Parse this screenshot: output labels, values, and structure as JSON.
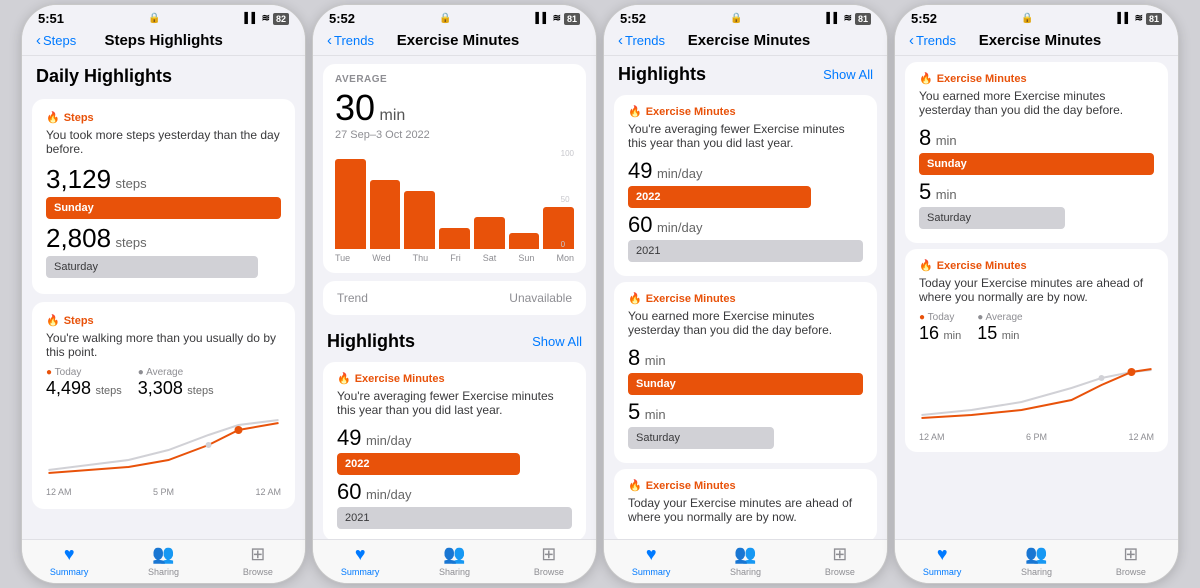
{
  "phones": [
    {
      "id": "phone1",
      "statusBar": {
        "time": "5:51",
        "icons": "▌▌ ≋ 82"
      },
      "navBack": "Steps",
      "navTitle": "Steps Highlights",
      "dailyHighlightsTitle": "Daily Highlights",
      "card1": {
        "category": "Steps",
        "desc": "You took more steps yesterday than the day before.",
        "value1": "3,129",
        "unit1": "steps",
        "bar1": "Sunday",
        "value2": "2,808",
        "unit2": "steps",
        "bar2": "Saturday"
      },
      "card2": {
        "category": "Steps",
        "desc": "You're walking more than you usually do by this point.",
        "todayLabel": "Today",
        "todayValue": "4,498",
        "todayUnit": "steps",
        "avgLabel": "Average",
        "avgValue": "3,308",
        "avgUnit": "steps"
      },
      "chartAxisLabels": [
        "12 AM",
        "5 PM",
        "12 AM"
      ],
      "tabItems": [
        {
          "label": "Summary",
          "icon": "♥",
          "active": true
        },
        {
          "label": "Sharing",
          "icon": "👤"
        },
        {
          "label": "Browse",
          "icon": "⊞"
        }
      ]
    },
    {
      "id": "phone2",
      "statusBar": {
        "time": "5:52",
        "icons": "▌▌ ≋ 81"
      },
      "navBack": "Trends",
      "navTitle": "Exercise Minutes",
      "avgLabel": "AVERAGE",
      "bigNumber": "30",
      "bigUnit": "min",
      "dateRange": "27 Sep–3 Oct 2022",
      "barChartLabels": [
        "Tue",
        "Wed",
        "Thu",
        "Fri",
        "Sat",
        "Sun",
        "Mon"
      ],
      "barChartValues": [
        85,
        65,
        55,
        20,
        30,
        15,
        40
      ],
      "barChartYLabels": [
        "100",
        "50",
        "0"
      ],
      "trendLabel": "Trend",
      "trendStatus": "Unavailable",
      "highlightsTitle": "Highlights",
      "showAllLabel": "Show All",
      "highlight1": {
        "category": "Exercise Minutes",
        "desc": "You're averaging fewer Exercise minutes this year than you did last year.",
        "value1": "49",
        "unit1": "min/day",
        "bar1": "2022",
        "value2": "60"
      },
      "tabItems": [
        {
          "label": "Summary",
          "icon": "♥",
          "active": true
        },
        {
          "label": "Sharing",
          "icon": "👤"
        },
        {
          "label": "Browse",
          "icon": "⊞"
        }
      ]
    },
    {
      "id": "phone3",
      "statusBar": {
        "time": "5:52",
        "icons": "▌▌ ≋ 81"
      },
      "navBack": "Trends",
      "navTitle": "Exercise Minutes",
      "highlightsTitle": "Highlights",
      "showAllLabel": "Show All",
      "highlight1": {
        "category": "Exercise Minutes",
        "desc": "You're averaging fewer Exercise minutes this year than you did last year.",
        "value1": "49",
        "unit1": "min/day",
        "bar1": "2022",
        "bar1Width": "78",
        "value2": "60",
        "unit2": "min/day",
        "bar2": "2021",
        "bar2Width": "100"
      },
      "highlight2": {
        "category": "Exercise Minutes",
        "desc": "You earned more Exercise minutes yesterday than you did the day before.",
        "value1": "8",
        "unit1": "min",
        "bar1": "Sunday",
        "value2": "5",
        "unit2": "min",
        "bar2": "Saturday"
      },
      "highlight3": {
        "category": "Exercise Minutes",
        "desc": "Today your Exercise minutes are ahead of where you normally are by now."
      },
      "tabItems": [
        {
          "label": "Summary",
          "icon": "♥",
          "active": true
        },
        {
          "label": "Sharing",
          "icon": "👤"
        },
        {
          "label": "Browse",
          "icon": "⊞"
        }
      ]
    },
    {
      "id": "phone4",
      "statusBar": {
        "time": "5:52",
        "icons": "▌▌ ≋ 81"
      },
      "navBack": "Trends",
      "navTitle": "Exercise Minutes",
      "highlight1": {
        "category": "Exercise Minutes",
        "desc": "You earned more Exercise minutes yesterday than you did the day before.",
        "value1": "8",
        "unit1": "min",
        "bar1": "Sunday",
        "bar1Width": "100",
        "value2": "5",
        "unit2": "min",
        "bar2": "Saturday",
        "bar2Width": "62"
      },
      "highlight2": {
        "category": "Exercise Minutes",
        "desc": "Today your Exercise minutes are ahead of where you normally are by now.",
        "todayLabel": "Today",
        "todayValue": "16",
        "todayUnit": "min",
        "avgLabel": "Average",
        "avgValue": "15",
        "avgUnit": "min"
      },
      "chartAxisLabels": [
        "12 AM",
        "6 PM",
        "12 AM"
      ],
      "tabItems": [
        {
          "label": "Summary",
          "icon": "♥",
          "active": true
        },
        {
          "label": "Sharing",
          "icon": "👤"
        },
        {
          "label": "Browse",
          "icon": "⊞"
        }
      ]
    }
  ]
}
